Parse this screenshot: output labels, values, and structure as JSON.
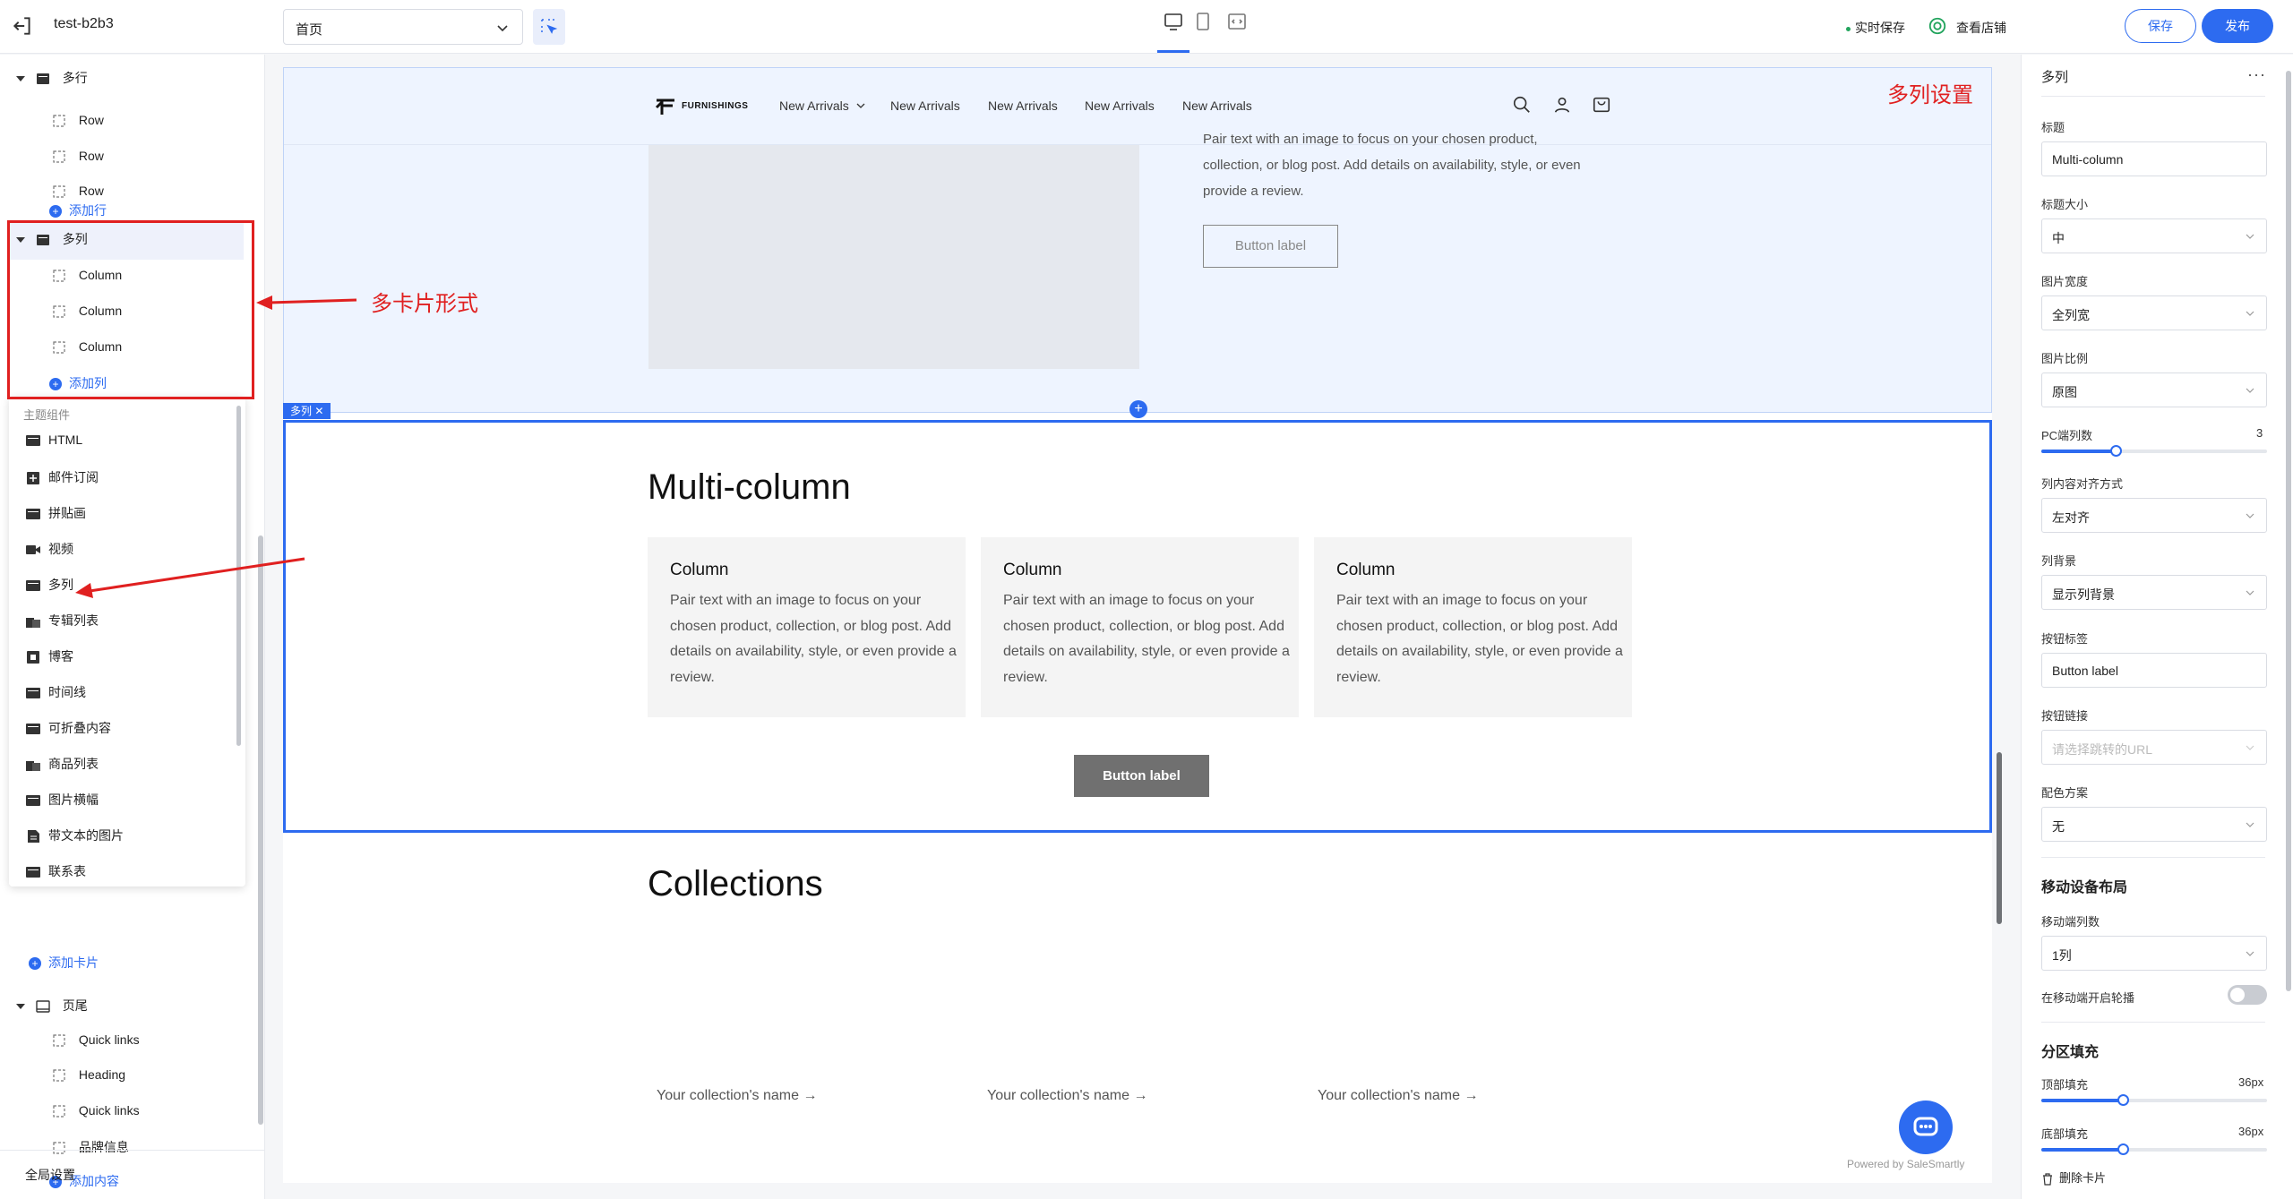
{
  "topbar": {
    "store_name": "test-b2b3",
    "page_select": "首页",
    "realtime_save": "实时保存",
    "view_store": "查看店铺",
    "save": "保存",
    "publish": "发布"
  },
  "sidebar": {
    "section_multirow": "多行",
    "rows": [
      "Row",
      "Row",
      "Row"
    ],
    "add_row": "添加行",
    "section_multicolumn": "多列",
    "columns": [
      "Column",
      "Column",
      "Column"
    ],
    "add_column": "添加列",
    "component_popup": {
      "header": "主题组件",
      "items": [
        "HTML",
        "邮件订阅",
        "拼贴画",
        "视频",
        "多列",
        "专辑列表",
        "博客",
        "时间线",
        "可折叠内容",
        "商品列表",
        "图片横幅",
        "带文本的图片",
        "联系表"
      ]
    },
    "add_card": "添加卡片",
    "section_footer": "页尾",
    "footer_items": [
      "Quick links",
      "Heading",
      "Quick links",
      "品牌信息"
    ],
    "add_content": "添加内容",
    "global_settings": "全局设置"
  },
  "annotations": {
    "multi_card_form": "多卡片形式",
    "multi_column_settings": "多列设置"
  },
  "canvas": {
    "nav": {
      "logo_text": "FURNISHINGS",
      "links": [
        "New Arrivals",
        "New Arrivals",
        "New Arrivals",
        "New Arrivals",
        "New Arrivals"
      ]
    },
    "hero": {
      "text": "Pair text with an image to focus on your chosen product, collection, or blog post. Add details on availability, style, or even provide a review.",
      "button": "Button label"
    },
    "section_tag": "多列 ✕",
    "multicolumn": {
      "title": "Multi-column",
      "columns": [
        {
          "title": "Column",
          "text": "Pair text with an image to focus on your chosen product, collection, or blog post. Add details on availability, style, or even provide a review."
        },
        {
          "title": "Column",
          "text": "Pair text with an image to focus on your chosen product, collection, or blog post. Add details on availability, style, or even provide a review."
        },
        {
          "title": "Column",
          "text": "Pair text with an image to focus on your chosen product, collection, or blog post. Add details on availability, style, or even provide a review."
        }
      ],
      "button": "Button label"
    },
    "collections": {
      "title": "Collections",
      "names": [
        "Your collection's name →",
        "Your collection's name →",
        "Your collection's name →"
      ]
    },
    "powered_by": "Powered by SaleSmartly"
  },
  "settings": {
    "title": "多列",
    "title_label": "标题",
    "title_value": "Multi-column",
    "title_size_label": "标题大小",
    "title_size_value": "中",
    "image_width_label": "图片宽度",
    "image_width_value": "全列宽",
    "image_ratio_label": "图片比例",
    "image_ratio_value": "原图",
    "pc_columns_label": "PC端列数",
    "pc_columns_value": "3",
    "pc_columns_fraction": 0.33,
    "align_label": "列内容对齐方式",
    "align_value": "左对齐",
    "bg_label": "列背景",
    "bg_value": "显示列背景",
    "button_label_label": "按钮标签",
    "button_label_value": "Button label",
    "button_link_label": "按钮链接",
    "button_link_placeholder": "请选择跳转的URL",
    "color_scheme_label": "配色方案",
    "color_scheme_value": "无",
    "mobile_layout_title": "移动设备布局",
    "mobile_columns_label": "移动端列数",
    "mobile_columns_value": "1列",
    "mobile_carousel_label": "在移动端开启轮播",
    "mobile_carousel_on": false,
    "padding_title": "分区填充",
    "top_padding_label": "顶部填充",
    "top_padding_value": "36px",
    "top_padding_fraction": 0.36,
    "bottom_padding_label": "底部填充",
    "bottom_padding_value": "36px",
    "bottom_padding_fraction": 0.36,
    "delete_card": "删除卡片"
  },
  "colors": {
    "accent": "#2d6bf0",
    "annotation_red": "#e02020",
    "live_dot": "#22a45d"
  }
}
